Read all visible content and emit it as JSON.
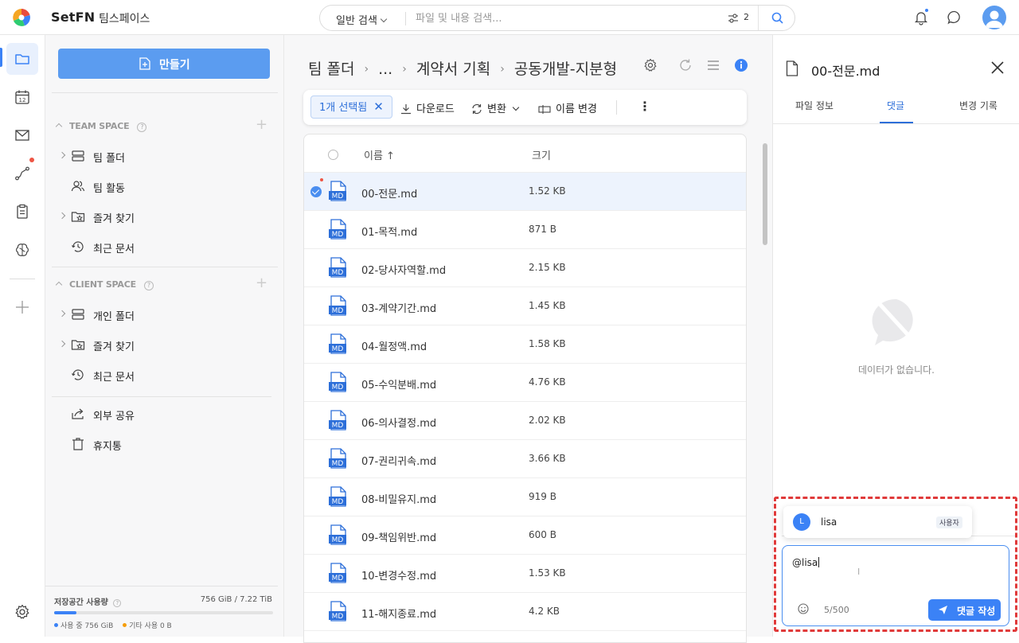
{
  "app": {
    "brand": "SetFN",
    "workspace": "팀스페이스"
  },
  "search": {
    "mode": "일반 검색",
    "placeholder": "파일 및 내용 검색...",
    "filter_count": "2"
  },
  "rail": {
    "items": [
      "folder-icon",
      "calendar-icon",
      "mail-icon",
      "workflow-icon",
      "clipboard-icon",
      "brain-icon",
      "plus-icon",
      "settings-icon"
    ],
    "calendar_day": "12"
  },
  "sidebar": {
    "create_label": "만들기",
    "team_space": {
      "header": "TEAM SPACE",
      "items": [
        {
          "label": "팀 폴더",
          "icon": "server-icon",
          "expandable": true
        },
        {
          "label": "팀 활동",
          "icon": "users-icon",
          "expandable": false
        },
        {
          "label": "즐겨 찾기",
          "icon": "star-folder-icon",
          "expandable": true
        },
        {
          "label": "최근 문서",
          "icon": "history-icon",
          "expandable": false
        }
      ]
    },
    "client_space": {
      "header": "CLIENT SPACE",
      "items": [
        {
          "label": "개인 폴더",
          "icon": "server-icon",
          "expandable": true
        },
        {
          "label": "즐겨 찾기",
          "icon": "star-folder-icon",
          "expandable": true
        },
        {
          "label": "최근 문서",
          "icon": "history-icon",
          "expandable": false
        }
      ]
    },
    "extra": [
      {
        "label": "외부 공유",
        "icon": "share-icon"
      },
      {
        "label": "휴지통",
        "icon": "trash-icon"
      }
    ],
    "storage": {
      "title": "저장공간 사용량",
      "value": "756 GiB / 7.22 TiB",
      "used_fraction": 0.1,
      "used_label": "사용 중 756 GiB",
      "other_label": "기타 사용 0 B",
      "used_color": "#3b82f6",
      "other_color": "#f59e0b"
    }
  },
  "breadcrumb": {
    "root": "팀 폴더",
    "ellipsis": "...",
    "parent": "계약서 기획",
    "current": "공동개발-지분형"
  },
  "toolbar": {
    "selected": "1개 선택됨",
    "download": "다운로드",
    "convert": "변환",
    "rename": "이름 변경"
  },
  "filelist": {
    "col_name": "이름 ↑",
    "col_size": "크기",
    "icon_label": "MD",
    "rows": [
      {
        "name": "00-전문.md",
        "size": "1.52 KB",
        "selected": true
      },
      {
        "name": "01-목적.md",
        "size": "871 B"
      },
      {
        "name": "02-당사자역할.md",
        "size": "2.15 KB"
      },
      {
        "name": "03-계약기간.md",
        "size": "1.45 KB"
      },
      {
        "name": "04-월정액.md",
        "size": "1.58 KB"
      },
      {
        "name": "05-수익분배.md",
        "size": "4.76 KB"
      },
      {
        "name": "06-의사결정.md",
        "size": "2.02 KB"
      },
      {
        "name": "07-권리귀속.md",
        "size": "3.66 KB"
      },
      {
        "name": "08-비밀유지.md",
        "size": "919 B"
      },
      {
        "name": "09-책임위반.md",
        "size": "600 B"
      },
      {
        "name": "10-변경수정.md",
        "size": "1.53 KB"
      },
      {
        "name": "11-해지종료.md",
        "size": "4.2 KB"
      }
    ]
  },
  "panel": {
    "title": "00-전문.md",
    "tabs": [
      "파일 정보",
      "댓글",
      "변경 기록"
    ],
    "active_tab": "댓글",
    "empty_text": "데이터가 없습니다.",
    "mention": {
      "initial": "L",
      "name": "lisa",
      "tag": "사용자"
    },
    "comment": {
      "value": "@lisa",
      "counter": "5/500",
      "submit": "댓글 작성"
    }
  },
  "colors": {
    "accent": "#3b82f6",
    "highlight": "#e03a3a"
  }
}
